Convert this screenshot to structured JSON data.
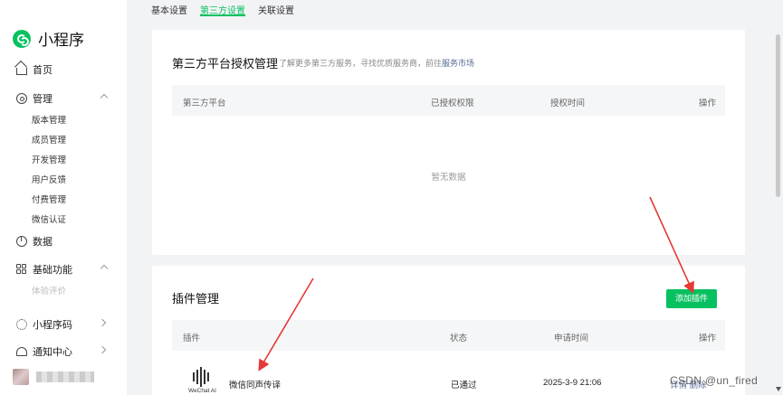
{
  "sidebar": {
    "app_title": "小程序",
    "items": [
      {
        "label": "首页"
      },
      {
        "label": "管理"
      },
      {
        "label": "数据"
      },
      {
        "label": "基础功能"
      },
      {
        "label": "小程序码"
      },
      {
        "label": "通知中心"
      }
    ],
    "management_sub": [
      "版本管理",
      "成员管理",
      "开发管理",
      "用户反馈",
      "付费管理",
      "微信认证"
    ],
    "basic_sub": [
      "体验评价"
    ]
  },
  "tabs": [
    {
      "label": "基本设置",
      "active": false
    },
    {
      "label": "第三方设置",
      "active": true
    },
    {
      "label": "关联设置",
      "active": false
    }
  ],
  "third_party": {
    "title": "第三方平台授权管理",
    "desc": "了解更多第三方服务，寻找优质服务商，前往",
    "desc_link": "服务市场",
    "columns": [
      "第三方平台",
      "已授权权限",
      "授权时间",
      "操作"
    ],
    "empty_text": "暂无数据"
  },
  "plugins": {
    "title": "插件管理",
    "add_button": "添加插件",
    "columns": [
      "插件",
      "状态",
      "申请时间",
      "操作"
    ],
    "rows": [
      {
        "logo_caption": "WeChat AI",
        "name": "微信同声传译",
        "status": "已通过",
        "time": "2025-3-9 21:06",
        "action": "详情 删除"
      }
    ]
  },
  "watermark": "CSDN @un_fired",
  "colors": {
    "accent": "#07c160",
    "annotation_arrow": "#e53935"
  }
}
